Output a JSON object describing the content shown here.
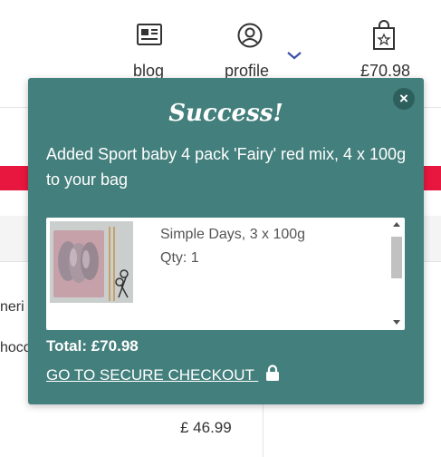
{
  "header": {
    "blog_label": "blog",
    "profile_label": "profile",
    "cart_total": "£70.98",
    "icons": [
      "newspaper-icon",
      "user-circle-icon",
      "chevron-down-icon",
      "shopping-bag-icon"
    ]
  },
  "background": {
    "card_text_1": "neri",
    "card_text_2": "hoco",
    "card_price": "£ 46.99"
  },
  "popup": {
    "title": "Success!",
    "message": "Added Sport baby 4 pack 'Fairy' red mix, 4 x 100g to your bag",
    "close_icon": "×",
    "item": {
      "name": "Simple Days, 3 x 100g",
      "qty": "Qty: 1"
    },
    "total": "Total: £70.98",
    "checkout_label": "GO TO SECURE CHECKOUT",
    "checkout_icon": "lock-icon"
  },
  "colors": {
    "popup_bg": "#437f7c",
    "accent_red": "#e8173f",
    "chevron_blue": "#3c4fa8"
  }
}
